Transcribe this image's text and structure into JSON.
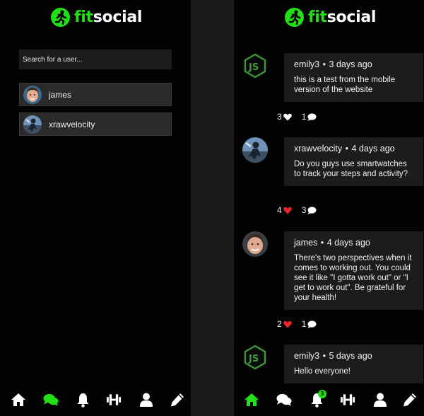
{
  "app": {
    "logo_fit": "fit",
    "logo_social": "social",
    "accent": "#22e016"
  },
  "search": {
    "placeholder": "Search for a user..."
  },
  "users": [
    {
      "name": "james"
    },
    {
      "name": "xrawvelocity"
    }
  ],
  "posts": [
    {
      "author": "emily3",
      "time": "3 days ago",
      "text": "this is a test from the mobile version of the website",
      "likes": "3",
      "liked": false,
      "comments": "1"
    },
    {
      "author": "xrawvelocity",
      "time": "4 days ago",
      "text": "Do you guys use smartwatches to track your steps and activity?",
      "likes": "4",
      "liked": true,
      "comments": "3"
    },
    {
      "author": "james",
      "time": "4 days ago",
      "text": "There's two perspectives when it comes to working out. You could see it like \"I gotta work out\" or \"I get to work out\". Be grateful for your health!",
      "likes": "2",
      "liked": true,
      "comments": "1"
    },
    {
      "author": "emily3",
      "time": "5 days ago",
      "text": "Hello everyone!"
    }
  ],
  "nav": {
    "left_active": "chat-icon",
    "right_active": "home-icon",
    "notifications_count": "3",
    "icons": [
      "home-icon",
      "chat-icon",
      "bell-icon",
      "dumbbell-icon",
      "user-icon",
      "pencil-icon"
    ]
  },
  "separator": "•"
}
